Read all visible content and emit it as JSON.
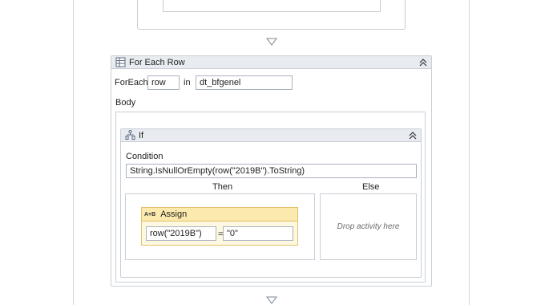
{
  "foreach": {
    "title": "For Each Row",
    "foreach_label": "ForEach",
    "item_value": "row",
    "in_label": "in",
    "collection_value": "dt_bfgenel",
    "body_label": "Body"
  },
  "if_activity": {
    "title": "If",
    "condition_label": "Condition",
    "condition_value": "String.IsNullOrEmpty(row(\"2019B\").ToString)",
    "then_label": "Then",
    "else_label": "Else",
    "else_placeholder": "Drop activity here"
  },
  "assign": {
    "icon_text": "A+B",
    "title": "Assign",
    "to_value": "row(\"2019B\")",
    "equals": "=",
    "value": "\"0\""
  },
  "colors": {
    "header_bg": "#e8ecf1",
    "border": "#c9ced6",
    "assign_bg": "#fff8e0",
    "assign_header": "#fbe9ad"
  }
}
